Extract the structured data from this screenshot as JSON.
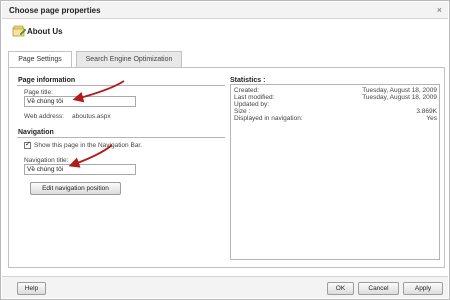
{
  "window": {
    "title": "Choose page properties",
    "close_glyph": "×"
  },
  "header": {
    "heading": "About Us",
    "icon": "page-edit-icon"
  },
  "tabs": [
    {
      "label": "Page Settings",
      "active": true
    },
    {
      "label": "Search Engine Optimization",
      "active": false
    }
  ],
  "page_information": {
    "title": "Page information",
    "page_title_label": "Page title:",
    "page_title_value": "Về chúng tôi",
    "web_address_label": "Web address:",
    "web_address_value": "aboutus.aspx"
  },
  "navigation": {
    "title": "Navigation",
    "show_label": "Show this page in the Navigation Bar.",
    "show_checked": true,
    "nav_title_label": "Navigation title:",
    "nav_title_value": "Về chúng tôi",
    "edit_button": "Edit navigation position"
  },
  "statistics": {
    "title": "Statistics :",
    "rows": [
      {
        "key": "Created:",
        "value": "Tuesday, August 18, 2009"
      },
      {
        "key": "Last modified:",
        "value": "Tuesday, August 18, 2009"
      },
      {
        "key": "Updated by:",
        "value": ""
      },
      {
        "key": "Size :",
        "value": "3.869K"
      },
      {
        "key": "Displayed in navigation:",
        "value": "Yes"
      }
    ]
  },
  "footer": {
    "help": "Help",
    "ok": "OK",
    "cancel": "Cancel",
    "apply": "Apply"
  },
  "colors": {
    "annotation_arrow": "#b01c1c"
  }
}
